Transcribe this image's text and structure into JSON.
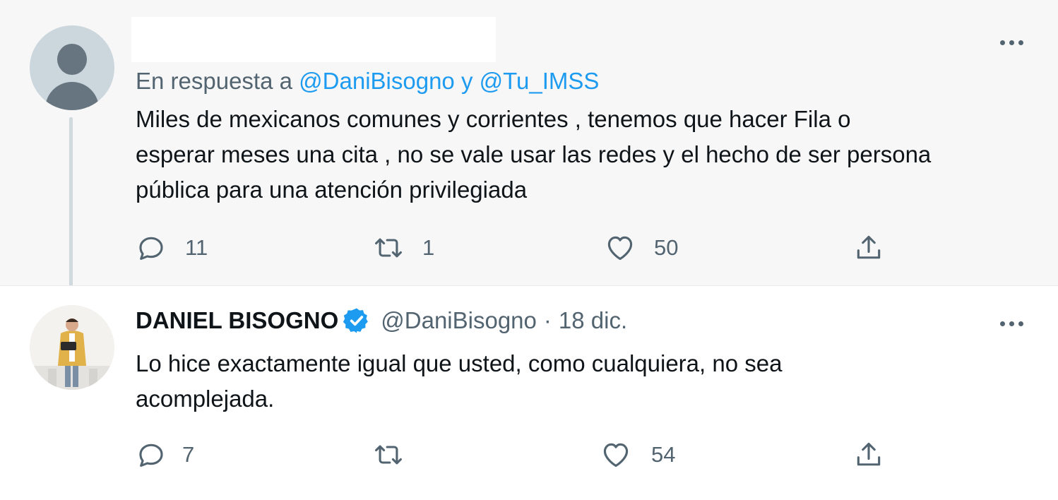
{
  "tweet1": {
    "author_name": "",
    "reply_prefix": "En respuesta a",
    "reply_user1": "@DaniBisogno",
    "reply_conjunction": "y",
    "reply_user2": "@Tu_IMSS",
    "text_lines": [
      "Miles de mexicanos comunes y corrientes , tenemos que hacer Fila o",
      "esperar meses una cita , no se vale usar las redes y el hecho de ser persona",
      "pública para una atención privilegiada"
    ],
    "replies": "11",
    "retweets": "1",
    "likes": "50",
    "avatar_icon": "default-avatar-icon"
  },
  "tweet2": {
    "display_name": "DANIEL BISOGNO",
    "verified_icon": "verified-badge-icon",
    "handle": "@DaniBisogno",
    "separator": "·",
    "date": "18 dic.",
    "text_lines": [
      "Lo hice exactamente igual que usted, como cualquiera, no sea",
      "acomplejada."
    ],
    "replies": "7",
    "retweets": "",
    "likes": "54"
  },
  "icons": {
    "reply": "reply-bubble-icon",
    "retweet": "retweet-arrows-icon",
    "like": "heart-icon",
    "share": "share-upload-icon",
    "more": "more-dots-icon"
  },
  "colors": {
    "link": "#1d9bf0",
    "secondary_text": "#536471",
    "primary_text": "#0f1419",
    "thread_line": "#cfd9de",
    "highlight_bg": "#f7f7f7"
  }
}
